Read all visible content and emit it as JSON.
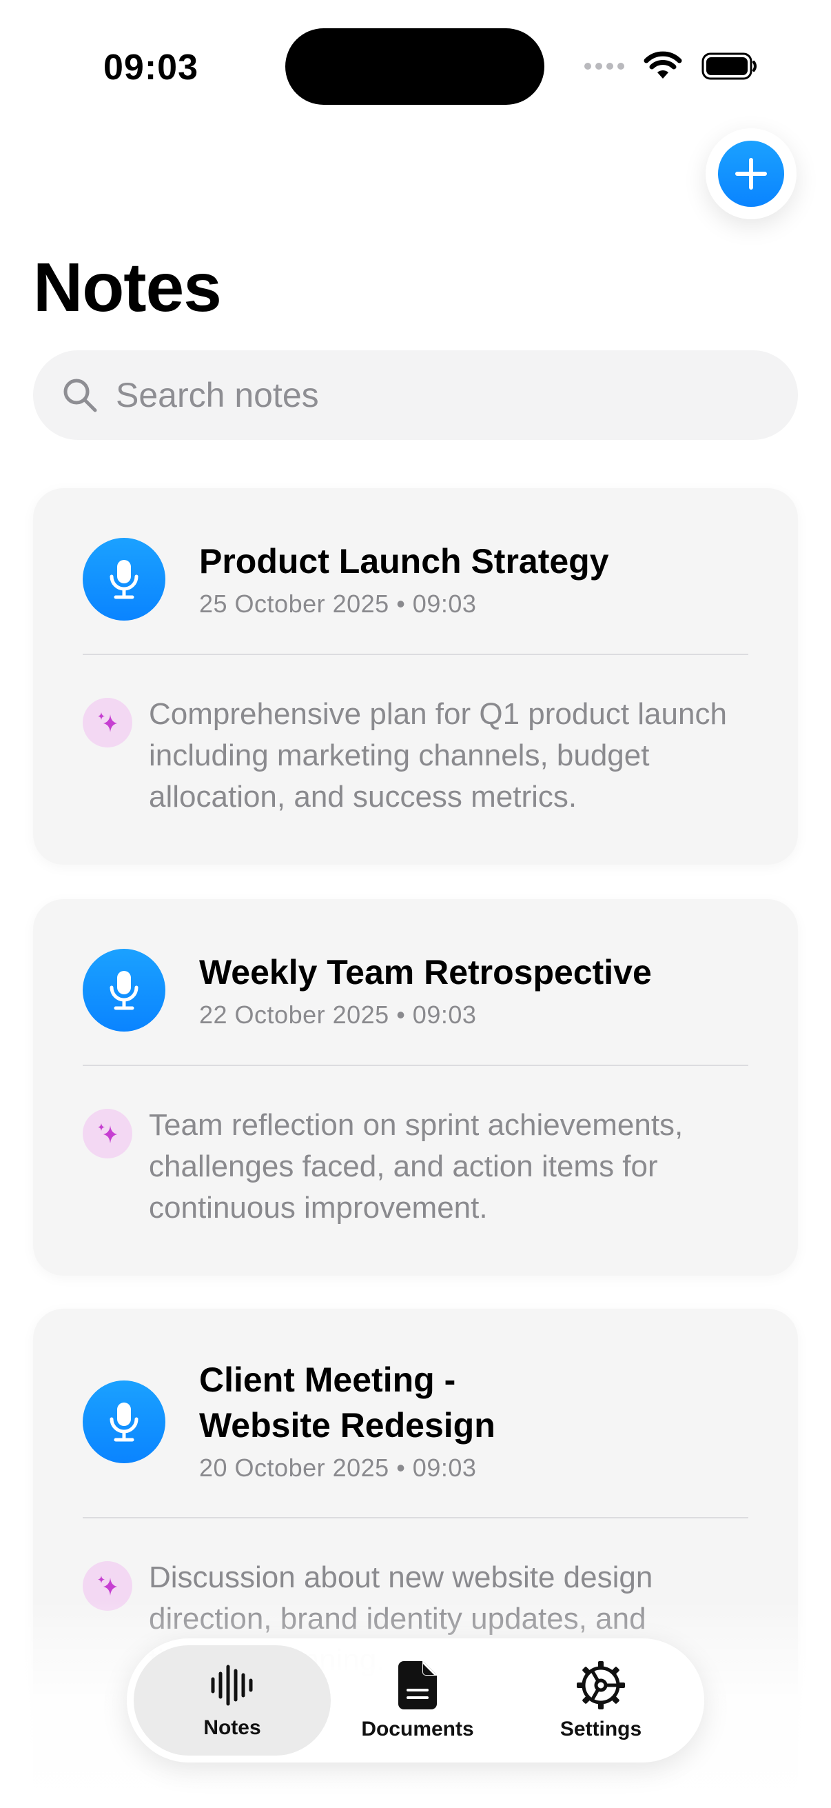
{
  "status_bar": {
    "time": "09:03"
  },
  "header": {
    "title": "Notes",
    "add_icon": "plus-icon"
  },
  "search": {
    "placeholder": "Search notes",
    "value": ""
  },
  "notes": [
    {
      "title": "Product Launch Strategy",
      "date": "25 October 2025 • 09:03",
      "summary": "Comprehensive plan for Q1 product launch including marketing channels, budget allocation, and success metrics."
    },
    {
      "title": "Weekly Team Retrospective",
      "date": "22 October 2025 • 09:03",
      "summary": "Team reflection on sprint achievements, challenges faced, and action items for continuous improvement."
    },
    {
      "title_line1": "Client Meeting -",
      "title_line2": "Website Redesign",
      "date": "20 October 2025 • 09:03",
      "summary": "Discussion about new website design direction, brand identity updates, and timeline planning."
    }
  ],
  "tab_bar": {
    "tabs": [
      {
        "label": "Notes",
        "icon": "waveform-icon",
        "selected": true
      },
      {
        "label": "Documents",
        "icon": "document-icon",
        "selected": false
      },
      {
        "label": "Settings",
        "icon": "gear-icon",
        "selected": false
      }
    ]
  },
  "colors": {
    "accent": "#0a84ff",
    "card_background": "#f5f5f5",
    "sparkle": "#c63fd1",
    "sparkle_background": "#f3d8f3",
    "secondary_text": "#8a8a8e"
  }
}
